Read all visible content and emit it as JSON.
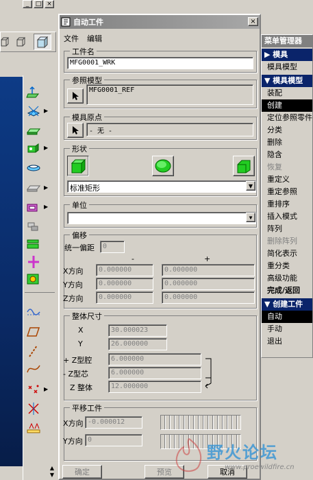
{
  "window_controls": [
    "_",
    "□",
    "×"
  ],
  "dialog": {
    "title": "自动工件",
    "close": "×",
    "menu": [
      "文件",
      "编辑"
    ],
    "workpiece_name": {
      "label": "工件名",
      "value": "MFG0001_WRK"
    },
    "ref_model": {
      "label": "参照模型",
      "value": "MFG0001_REF"
    },
    "mold_origin": {
      "label": "模具原点",
      "value": "- 无 -"
    },
    "shape": {
      "label": "形状",
      "select": "标准矩形"
    },
    "unit": {
      "label": "单位",
      "select": ""
    },
    "offset": {
      "label": "偏移",
      "uniform_label": "统一偏距",
      "uniform": "0",
      "minus": "-",
      "plus": "+",
      "rows": [
        {
          "label": "X方向",
          "minus": "0.000000",
          "plus": "0.000000"
        },
        {
          "label": "Y方向",
          "minus": "0.000000",
          "plus": "0.000000"
        },
        {
          "label": "Z方向",
          "minus": "0.000000",
          "plus": "0.000000"
        }
      ]
    },
    "overall": {
      "label": "整体尺寸",
      "rows": [
        {
          "label": "X",
          "value": "30.000023"
        },
        {
          "label": "Y",
          "value": "26.000000"
        },
        {
          "label": "+ Z型腔",
          "value": "6.000000"
        },
        {
          "label": "- Z型芯",
          "value": "6.000000"
        },
        {
          "label": "Z 整体",
          "value": "12.000000"
        }
      ]
    },
    "translate": {
      "label": "平移工件",
      "x_label": "X方向",
      "x_value": "-0.000012",
      "y_label": "Y方向",
      "y_value": "0"
    },
    "buttons": {
      "ok": "确定",
      "preview": "预览",
      "cancel": "取消"
    }
  },
  "menu_manager": {
    "title": "菜单管理器",
    "sec1": {
      "head": "模具",
      "items": [
        "模具模型"
      ]
    },
    "sec2": {
      "head": "模具模型",
      "items": [
        "装配",
        "创建",
        "定位参照零件",
        "分类",
        "删除",
        "隐含",
        "恢复",
        "重定义",
        "重定参照",
        "重排序",
        "插入模式",
        "阵列",
        "删除阵列",
        "简化表示",
        "重分类",
        "高级功能",
        "完成/返回"
      ]
    },
    "sec3": {
      "head": "创建工件",
      "items": [
        "自动",
        "手动",
        "退出"
      ]
    }
  },
  "watermark": {
    "text": "野火论坛",
    "url": "www.proewildfire.cn"
  }
}
